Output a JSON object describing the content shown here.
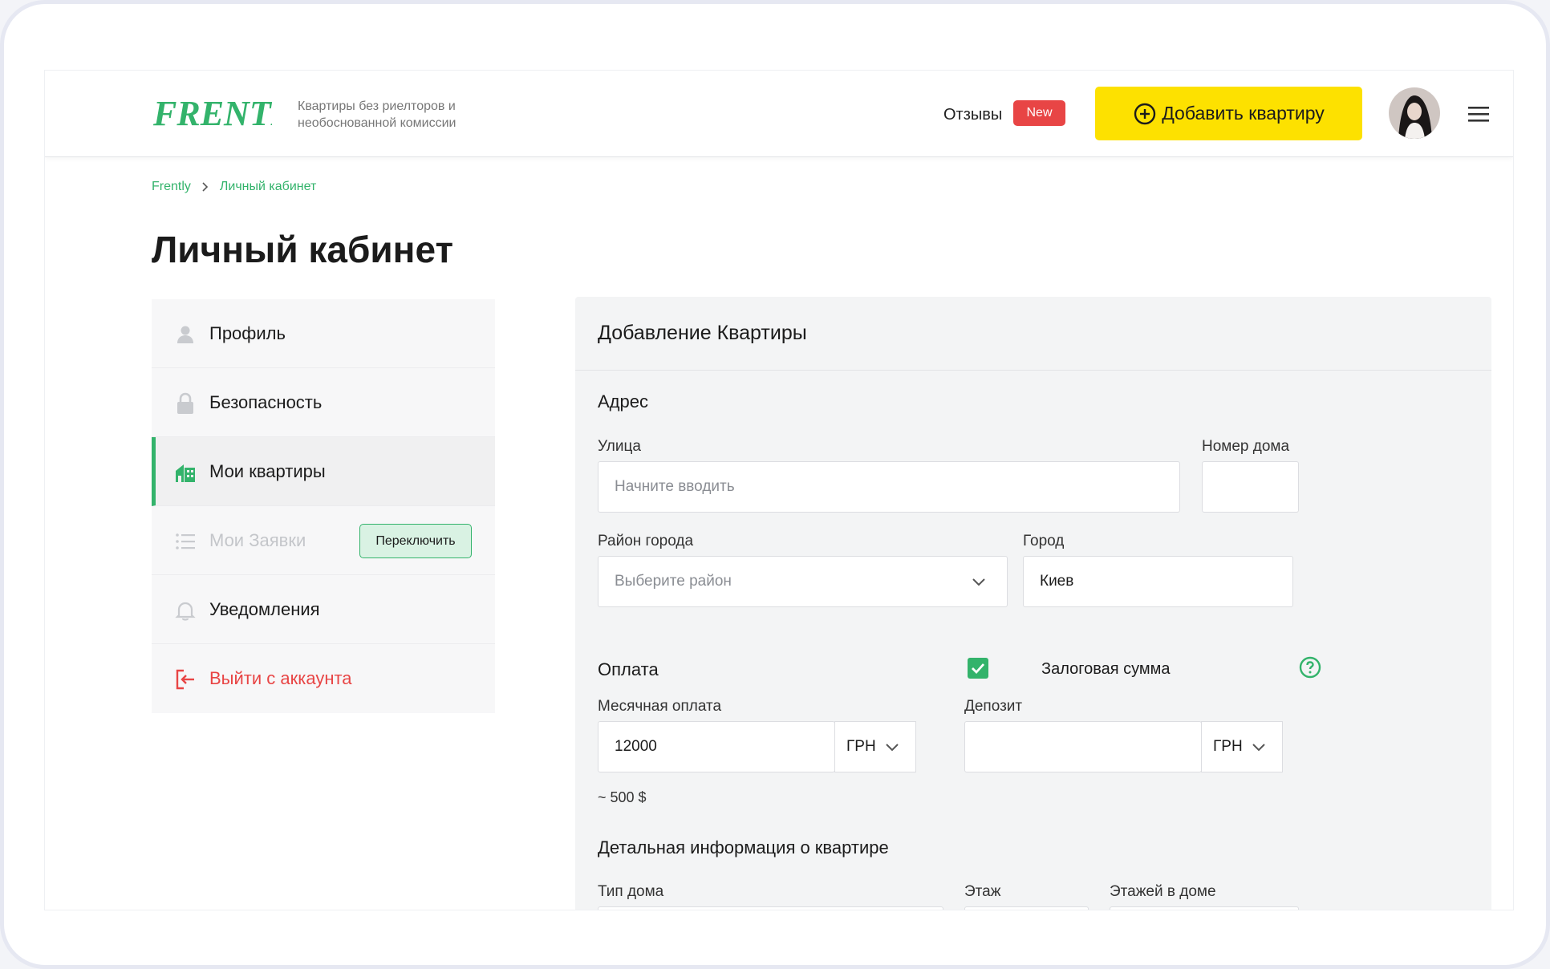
{
  "header": {
    "logo_text": "FRENTLY",
    "tagline": "Квартиры без риелторов и необоснованной комиссии",
    "reviews_label": "Отзывы",
    "new_badge": "New",
    "add_button": "Добавить квартиру"
  },
  "breadcrumb": [
    "Frently",
    "Личный кабинет"
  ],
  "page_title": "Личный кабинет",
  "sidebar": {
    "items": [
      {
        "label": "Профиль",
        "icon": "user-icon"
      },
      {
        "label": "Безопасность",
        "icon": "lock-icon"
      },
      {
        "label": "Мои квартиры",
        "icon": "building-icon",
        "active": true
      },
      {
        "label": "Мои Заявки",
        "icon": "list-icon",
        "disabled": true,
        "action": "Переключить"
      },
      {
        "label": "Уведомления",
        "icon": "bell-icon"
      },
      {
        "label": "Выйти с аккаунта",
        "icon": "logout-icon"
      }
    ]
  },
  "form": {
    "title": "Добавление Квартиры",
    "address": {
      "section": "Адрес",
      "street_label": "Улица",
      "street_placeholder": "Начните вводить",
      "house_label": "Номер дома",
      "district_label": "Район города",
      "district_placeholder": "Выберите район",
      "city_label": "Город",
      "city_value": "Киев"
    },
    "payment": {
      "section": "Оплата",
      "deposit_check_label": "Залоговая сумма",
      "monthly_label": "Месячная оплата",
      "monthly_value": "12000",
      "monthly_currency": "ГРН",
      "monthly_hint": "~ 500 $",
      "deposit_label": "Депозит",
      "deposit_currency": "ГРН"
    },
    "details": {
      "section": "Детальная информация о квартире",
      "house_type_label": "Тип дома",
      "floor_label": "Этаж",
      "floors_total_label": "Этажей в доме"
    }
  },
  "colors": {
    "accent_green": "#33b36b",
    "button_yellow": "#fde100",
    "badge_red": "#e84545"
  }
}
